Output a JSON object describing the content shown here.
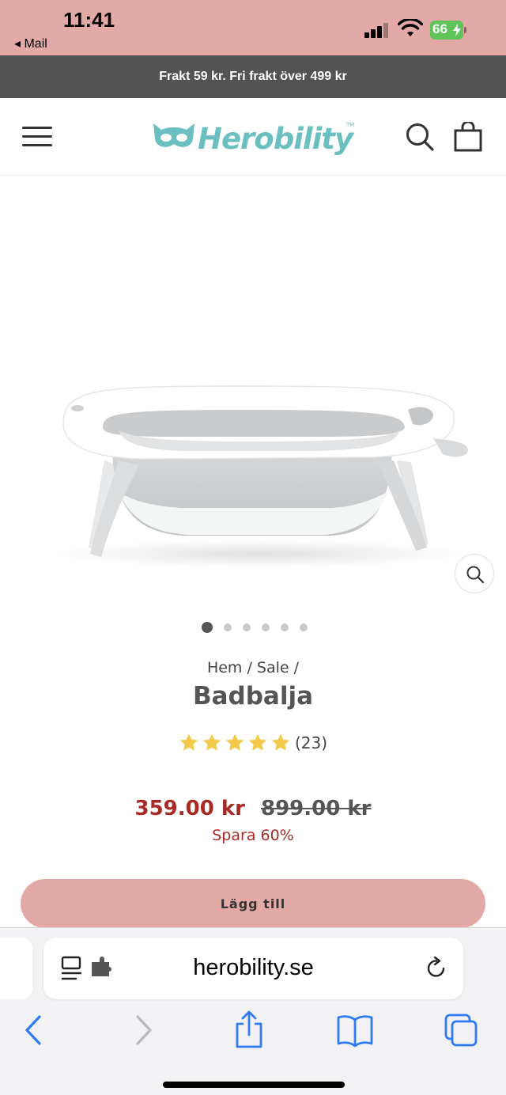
{
  "status_bar": {
    "time": "11:41",
    "back_label": "◂ Mail",
    "battery": "66"
  },
  "announcement": "Frakt 59 kr. Fri frakt över 499 kr",
  "header": {
    "logo_text": "Herobility",
    "logo_color": "#6cbfc0"
  },
  "gallery": {
    "image_count": 6,
    "active_index": 0
  },
  "product": {
    "breadcrumb": "Hem / Sale /",
    "title": "Badbalja",
    "rating": 5,
    "review_count": "(23)",
    "price_sale": "359.00 kr",
    "price_old": "899.00 kr",
    "savings": "Spara 60%",
    "add_button": "Lägg till"
  },
  "browser": {
    "url": "herobility.se"
  },
  "colors": {
    "status_bar": "#e3a9a6",
    "announcement_bg": "#535353",
    "sale_red": "#a82a25",
    "button_pink": "#e3a9a6",
    "star": "#f3c94a",
    "ios_blue": "#2f7bf5"
  }
}
